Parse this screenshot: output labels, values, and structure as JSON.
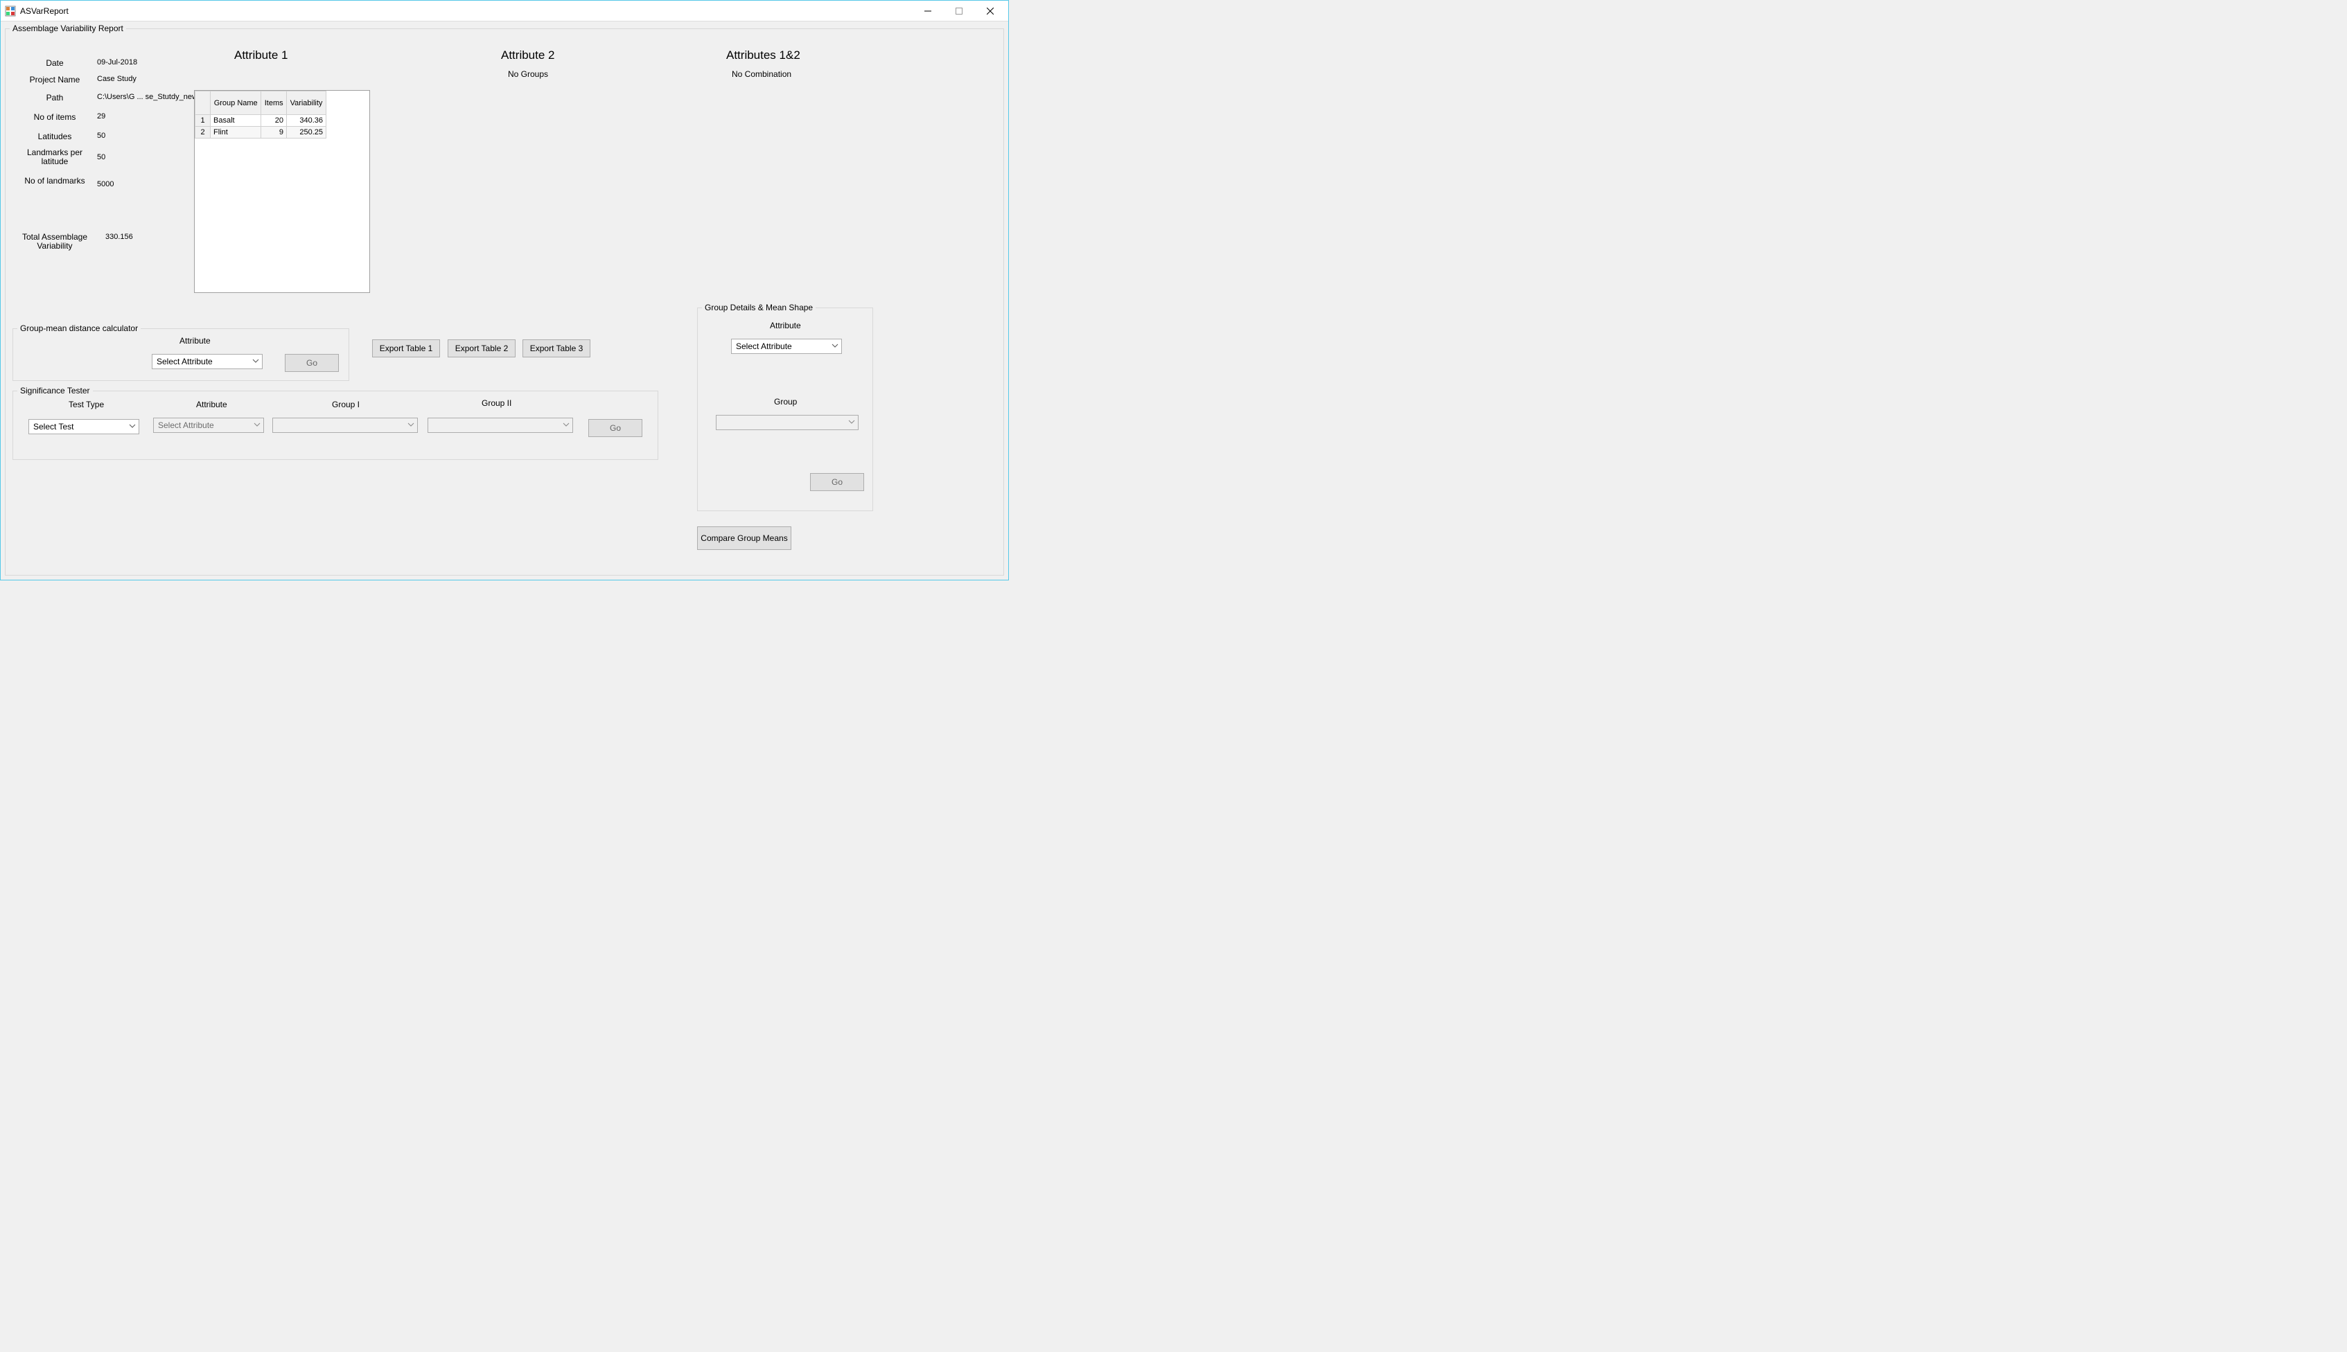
{
  "window": {
    "title": "ASVarReport"
  },
  "report": {
    "legend": "Assemblage Variability Report",
    "fields": {
      "date_label": "Date",
      "date_value": "09-Jul-2018",
      "project_label": "Project Name",
      "project_value": "Case Study",
      "path_label": "Path",
      "path_value": "C:\\Users\\G ... se_Stutdy_new\\",
      "items_label": "No of items",
      "items_value": "29",
      "lat_label": "Latitudes",
      "lat_value": "50",
      "lpl_label": "Landmarks per latitude",
      "lpl_value": "50",
      "nlm_label": "No of landmarks",
      "nlm_value": "5000",
      "tav_label": "Total Assemblage Variability",
      "tav_value": "330.156"
    }
  },
  "attributes": {
    "attr1": {
      "heading": "Attribute 1",
      "table": {
        "headers": [
          "Group Name",
          "Items",
          "Variability"
        ],
        "rows": [
          {
            "n": "1",
            "name": "Basalt",
            "items": "20",
            "var": "340.36"
          },
          {
            "n": "2",
            "name": "Flint",
            "items": "9",
            "var": "250.25"
          }
        ]
      }
    },
    "attr2": {
      "heading": "Attribute 2",
      "sub": "No Groups"
    },
    "attr12": {
      "heading": "Attributes 1&2",
      "sub": "No Combination"
    }
  },
  "group_mean": {
    "legend": "Group-mean distance calculator",
    "attr_label": "Attribute",
    "select_placeholder": "Select Attribute",
    "go_label": "Go"
  },
  "exports": {
    "e1": "Export Table 1",
    "e2": "Export Table 2",
    "e3": "Export Table 3"
  },
  "sig": {
    "legend": "Significance Tester",
    "test_type_label": "Test Type",
    "attr_label": "Attribute",
    "g1_label": "Group I",
    "g2_label": "Group II",
    "test_select": "Select Test",
    "attr_select": "Select Attribute",
    "go_label": "Go"
  },
  "details": {
    "legend": "Group Details & Mean Shape",
    "attr_label": "Attribute",
    "attr_select": "Select Attribute",
    "group_label": "Group",
    "go_label": "Go"
  },
  "compare_label": "Compare Group Means"
}
